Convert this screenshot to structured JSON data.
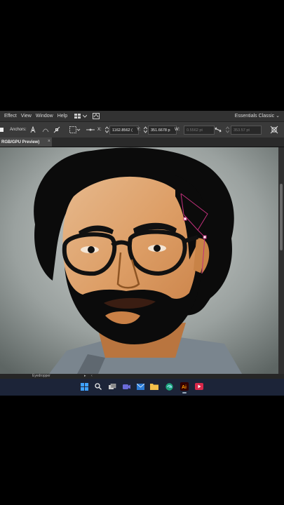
{
  "menubar": {
    "items": [
      "Effect",
      "View",
      "Window",
      "Help"
    ],
    "workspace": "Essentials Classic"
  },
  "control_bar": {
    "anchors_label": "Anchors:",
    "x_label": "X:",
    "x_value": "1162.8562 (",
    "y_label": "Y:",
    "y_value": "351.6678 p",
    "w_label": "W:",
    "w_value": "0.5562 pt",
    "h_value": "353.57 pt"
  },
  "document_tab": {
    "title": "RGB/GPU Preview)"
  },
  "status_bar": {
    "tool_name": "Eyedropper"
  },
  "taskbar": {
    "icons": [
      "windows-start",
      "search",
      "task-view",
      "meet",
      "mail",
      "file-explorer",
      "edge",
      "illustrator",
      "media"
    ],
    "active": "illustrator"
  },
  "colors": {
    "menubar_bg": "#323232",
    "control_bg": "#3a3a3a",
    "skin": "#e0a06a",
    "hair": "#0a0a0a",
    "shirt": "#7f8a94",
    "background_gray": "#9da4a2",
    "selection_path": "#c0307a",
    "taskbar_bg": "#1c2438"
  }
}
